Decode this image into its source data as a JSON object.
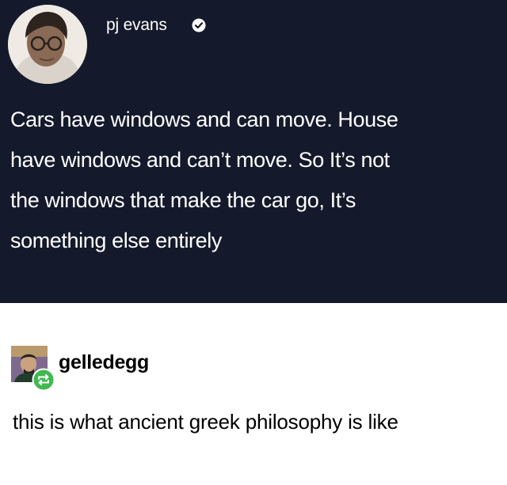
{
  "tweet": {
    "username": "pj evans",
    "avatar_icon": "user-avatar-photo",
    "verified_icon": "verified-check-icon",
    "text_lines": [
      "Cars have windows and can move. House",
      "have windows and can’t move. So It’s not",
      "the windows that make the car go, It’s",
      "something else entirely"
    ],
    "background_color": "#141a2b"
  },
  "reblog": {
    "username": "gelledegg",
    "avatar_icon": "user-avatar-photo",
    "reblog_icon": "reblog-icon",
    "comment": "this is what ancient greek philosophy is like",
    "reblog_icon_color": "#3fb950"
  }
}
